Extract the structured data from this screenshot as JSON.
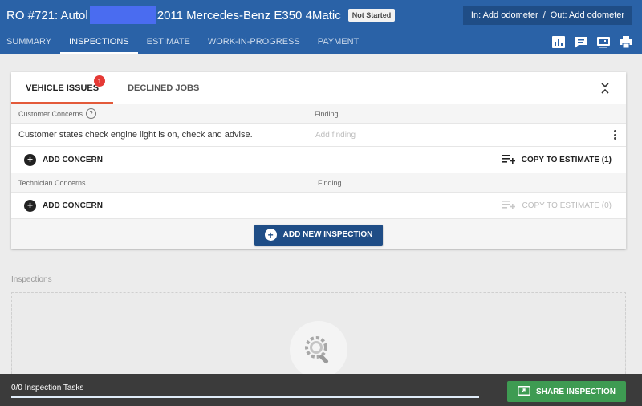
{
  "header": {
    "title_prefix": "RO #721: Autol",
    "vehicle": "2011 Mercedes-Benz E350 4Matic",
    "status": "Not Started",
    "odometer_in": "In: Add odometer",
    "odometer_separator": "/",
    "odometer_out": "Out: Add odometer"
  },
  "nav": {
    "tabs": [
      {
        "label": "Summary"
      },
      {
        "label": "Inspections"
      },
      {
        "label": "Estimate"
      },
      {
        "label": "Work-in-Progress"
      },
      {
        "label": "Payment"
      }
    ],
    "active_tab": "Inspections",
    "tool_icons": [
      "bar-chart-icon",
      "chat-icon",
      "monitor-share-icon",
      "print-icon"
    ]
  },
  "card": {
    "tabs": [
      {
        "label": "VEHICLE ISSUES",
        "badge": "1"
      },
      {
        "label": "DECLINED JOBS"
      }
    ],
    "customer": {
      "header_label": "Customer Concerns",
      "help_glyph": "?",
      "finding_header": "Finding",
      "concerns": [
        {
          "text": "Customer states check engine light is on, check and advise.",
          "finding_placeholder": "Add finding"
        }
      ],
      "add_label": "ADD CONCERN",
      "copy_label": "COPY TO ESTIMATE (1)"
    },
    "technician": {
      "header_label": "Technician Concerns",
      "finding_header": "Finding",
      "add_label": "ADD CONCERN",
      "copy_label": "COPY TO ESTIMATE (0)"
    },
    "new_inspection_label": "ADD NEW INSPECTION"
  },
  "inspections": {
    "label": "Inspections",
    "empty_icon": "gear-search-icon"
  },
  "footer": {
    "tasks_label": "0/0 Inspection Tasks",
    "progress": 1.0,
    "share_label": "SHARE INSPECTION"
  },
  "colors": {
    "header_bg": "#2a62a7",
    "primary_button": "#1f4d86",
    "share_button": "#3e9b52",
    "active_tab_underline": "#e35a3a",
    "badge": "#e53935"
  }
}
